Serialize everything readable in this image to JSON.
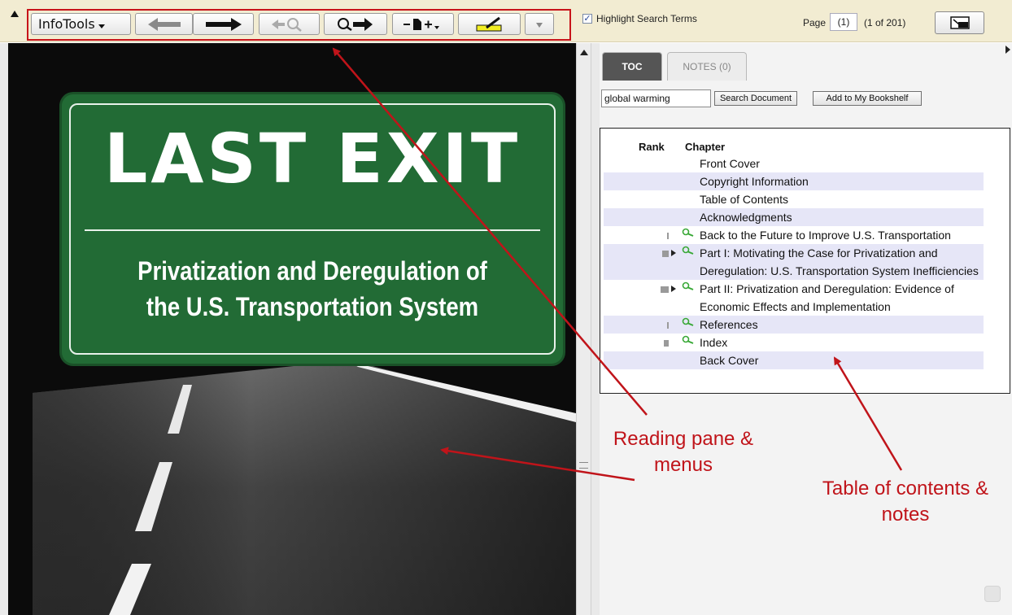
{
  "toolbar": {
    "infotools_label": "InfoTools",
    "buttons": [
      "back-arrow-icon",
      "forward-arrow-icon",
      "previous-search-hit-icon",
      "next-search-hit-icon",
      "page-add-icon",
      "highlighter-icon",
      "dropdown-icon"
    ],
    "highlight_label": "Highlight Search Terms",
    "highlight_checked": true,
    "page_label": "Page",
    "page_value": "(1)",
    "page_of": "(1 of 201)",
    "view_icon": "view-mode-icon"
  },
  "reading": {
    "cover_title": "LAST EXIT",
    "cover_subtitle_1": "Privatization and Deregulation of",
    "cover_subtitle_2": "the U.S. Transportation System"
  },
  "panel": {
    "tabs": [
      {
        "label": "TOC",
        "active": true
      },
      {
        "label": "NOTES (0)",
        "active": false
      }
    ],
    "search_value": "global warming",
    "search_button": "Search Document",
    "bookshelf_button": "Add to My Bookshelf",
    "toc_headers": {
      "rank": "Rank",
      "chapter": "Chapter"
    },
    "toc_rows": [
      {
        "text": "Front Cover",
        "rank": 0,
        "search_hit": false,
        "expandable": false
      },
      {
        "text": "Copyright Information",
        "rank": 0,
        "search_hit": false,
        "expandable": false
      },
      {
        "text": "Table of Contents",
        "rank": 0,
        "search_hit": false,
        "expandable": false
      },
      {
        "text": "Acknowledgments",
        "rank": 0,
        "search_hit": false,
        "expandable": false
      },
      {
        "text": "Back to the Future to Improve U.S. Transportation",
        "rank": 1,
        "search_hit": true,
        "expandable": false
      },
      {
        "text": "Part I: Motivating the Case for Privatization and Deregulation: U.S. Transportation System Inefficiencies",
        "rank": 4,
        "search_hit": true,
        "expandable": true
      },
      {
        "text": "Part II: Privatization and Deregulation: Evidence of Economic Effects and Implementation",
        "rank": 5,
        "search_hit": true,
        "expandable": true
      },
      {
        "text": "References",
        "rank": 1,
        "search_hit": true,
        "expandable": false
      },
      {
        "text": "Index",
        "rank": 3,
        "search_hit": true,
        "expandable": false
      },
      {
        "text": "Back Cover",
        "rank": 0,
        "search_hit": false,
        "expandable": false
      }
    ]
  },
  "annotations": {
    "reading_pane": "Reading pane & menus",
    "toc_notes": "Table of contents & notes",
    "color": "#c0141a"
  }
}
